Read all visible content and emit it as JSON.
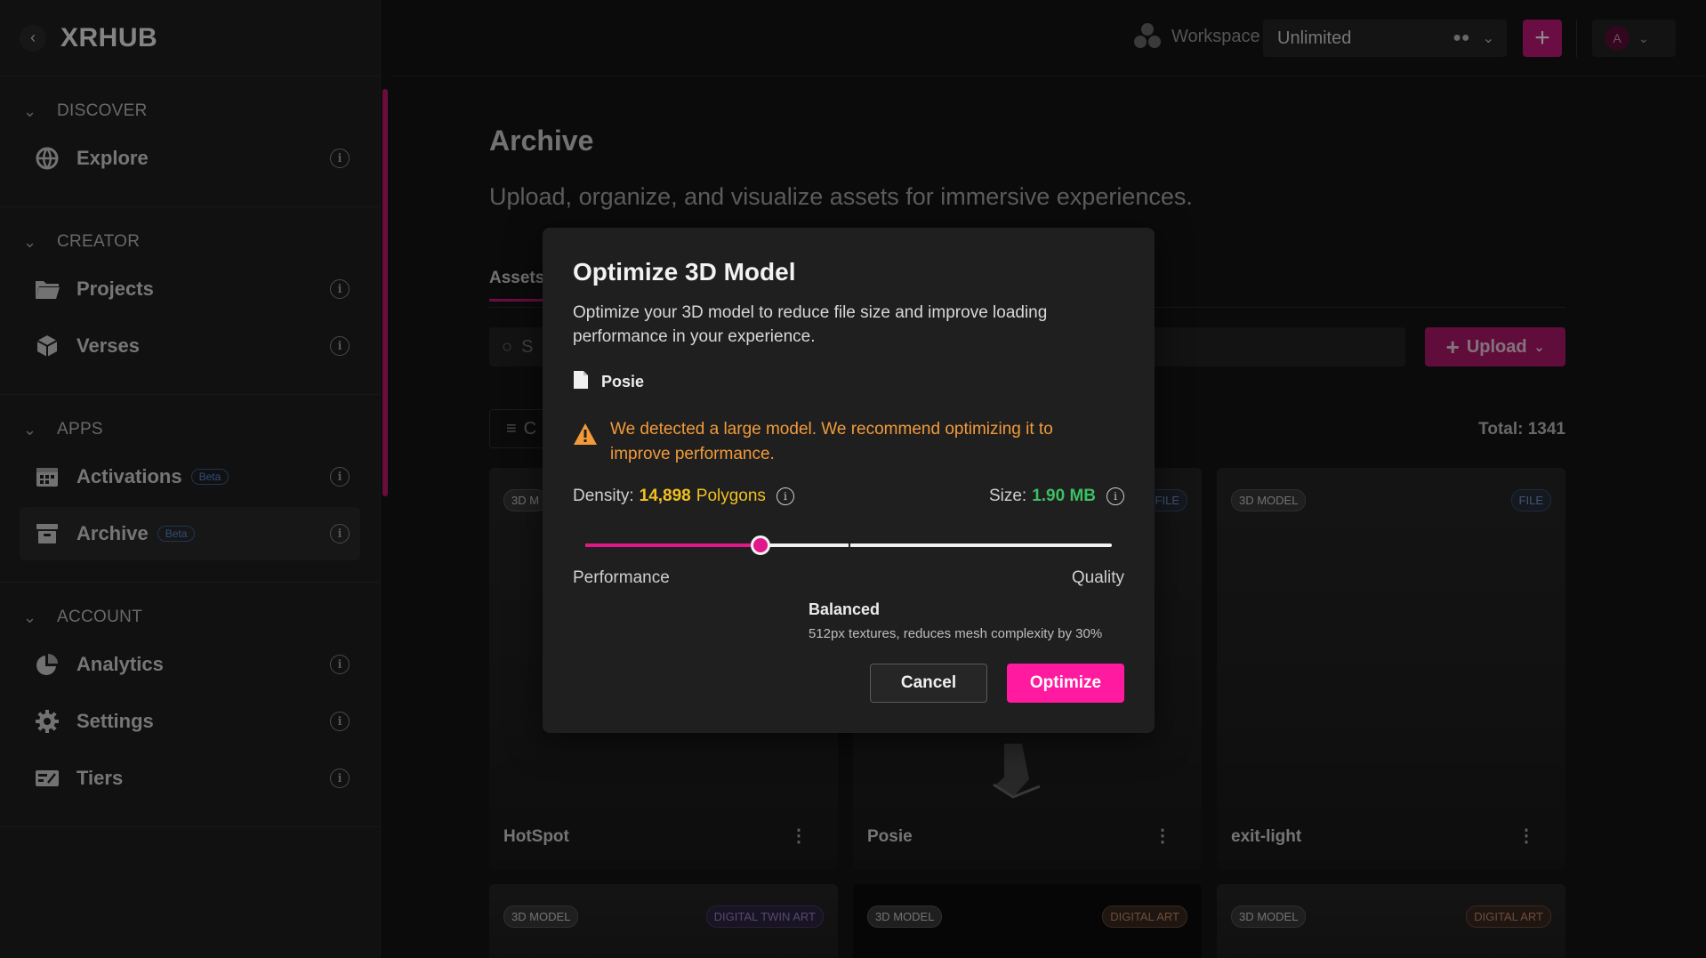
{
  "brand": {
    "name": "XRHUB"
  },
  "sidebar": {
    "sections": [
      {
        "title": "DISCOVER",
        "items": [
          {
            "label": "Explore",
            "icon": "globe-icon"
          }
        ]
      },
      {
        "title": "CREATOR",
        "items": [
          {
            "label": "Projects",
            "icon": "folder-icon"
          },
          {
            "label": "Verses",
            "icon": "cube-icon"
          }
        ]
      },
      {
        "title": "APPS",
        "items": [
          {
            "label": "Activations",
            "icon": "calendar-icon",
            "badge": "Beta"
          },
          {
            "label": "Archive",
            "icon": "archive-icon",
            "badge": "Beta",
            "active": true
          }
        ]
      },
      {
        "title": "ACCOUNT",
        "items": [
          {
            "label": "Analytics",
            "icon": "pie-chart-icon"
          },
          {
            "label": "Settings",
            "icon": "gear-icon"
          },
          {
            "label": "Tiers",
            "icon": "tiers-icon"
          }
        ]
      }
    ]
  },
  "topbar": {
    "workspace_label": "Workspace",
    "workspace_value": "Unlimited",
    "avatar_initial": "A"
  },
  "main": {
    "title": "Archive",
    "subtitle": "Upload, organize, and visualize assets for immersive experiences.",
    "tab": "Assets",
    "search_placeholder": "S",
    "filter_label": "C",
    "upload_label": "Upload",
    "total": "Total: 1341",
    "cards": [
      {
        "type": "3D M",
        "kind": "",
        "name": "HotSpot"
      },
      {
        "type": "",
        "kind": "FILE",
        "name": "Posie"
      },
      {
        "type": "3D MODEL",
        "kind": "FILE",
        "name": "exit-light"
      },
      {
        "type": "3D MODEL",
        "kind": "DIGITAL TWIN ART",
        "name": ""
      },
      {
        "type": "3D MODEL",
        "kind": "DIGITAL ART",
        "name": ""
      },
      {
        "type": "3D MODEL",
        "kind": "DIGITAL ART",
        "name": ""
      }
    ]
  },
  "modal": {
    "title": "Optimize 3D Model",
    "description": "Optimize your 3D model to reduce file size and improve loading performance in your experience.",
    "file_name": "Posie",
    "warning": "We detected a large model. We recommend optimizing it to improve performance.",
    "density_label": "Density:",
    "density_value": "14,898",
    "density_unit": "Polygons",
    "size_label": "Size:",
    "size_value": "1.90 MB",
    "slider_position": 0.333,
    "slider_min_label": "Performance",
    "slider_max_label": "Quality",
    "preset_name": "Balanced",
    "preset_desc": "512px textures, reduces mesh complexity by 30%",
    "cancel_label": "Cancel",
    "optimize_label": "Optimize",
    "accent_color": "#ff1aa0",
    "warning_color": "#f29a3a"
  }
}
